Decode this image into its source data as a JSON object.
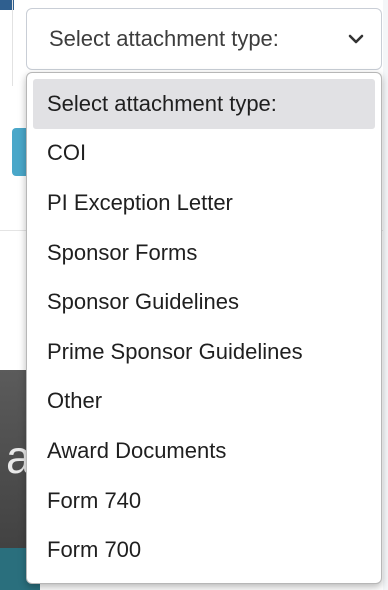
{
  "select": {
    "current_value": "Select attachment type:",
    "chevron_icon": "chevron-down-icon"
  },
  "options": [
    {
      "label": "Select attachment type:",
      "selected": true
    },
    {
      "label": "COI",
      "selected": false
    },
    {
      "label": "PI Exception Letter",
      "selected": false
    },
    {
      "label": "Sponsor Forms",
      "selected": false
    },
    {
      "label": "Sponsor Guidelines",
      "selected": false
    },
    {
      "label": "Prime Sponsor Guidelines",
      "selected": false
    },
    {
      "label": "Other",
      "selected": false
    },
    {
      "label": "Award Documents",
      "selected": false
    },
    {
      "label": "Form 740",
      "selected": false
    },
    {
      "label": "Form 700",
      "selected": false
    }
  ],
  "background": {
    "partial_letter": "a"
  },
  "colors": {
    "selected_option_bg": "#e1e1e4",
    "border": "#c9ced6",
    "accent_teal": "#4aa7c9",
    "dark_panel": "#4a4a4a"
  }
}
